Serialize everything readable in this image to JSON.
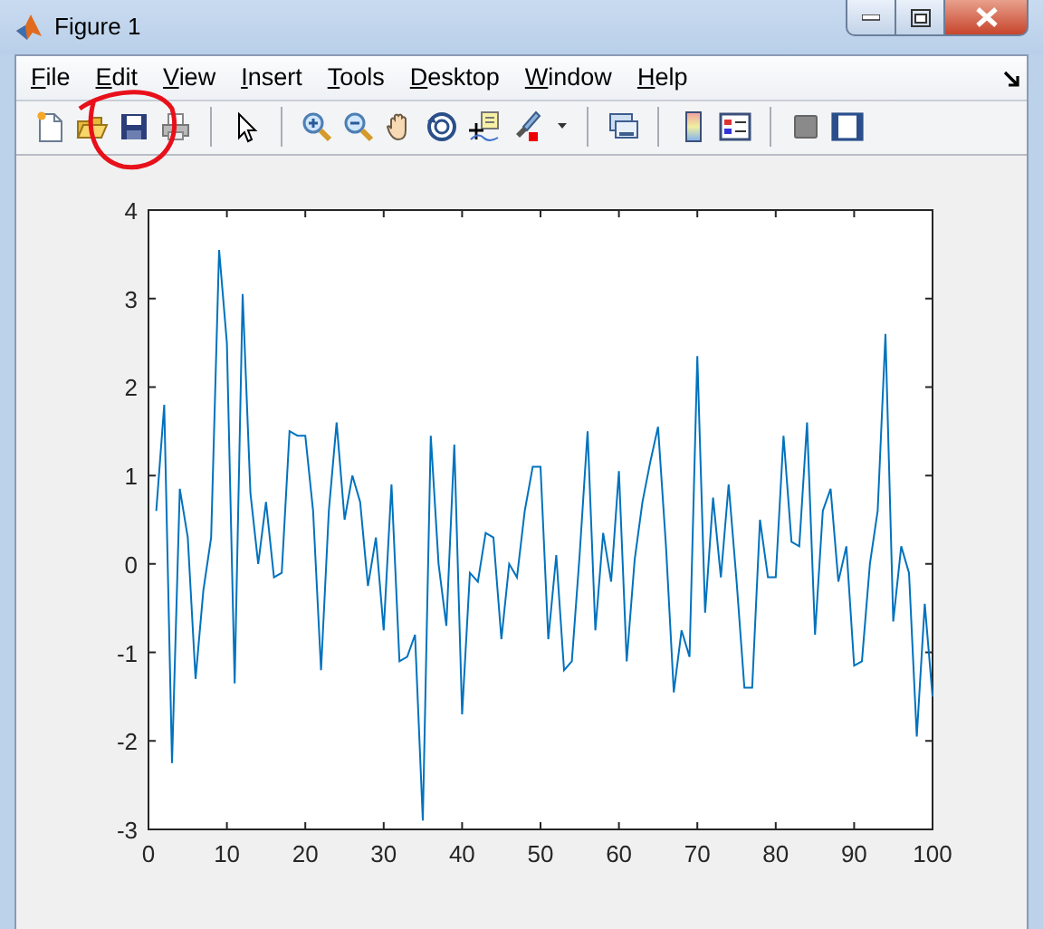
{
  "window": {
    "title": "Figure 1"
  },
  "menu_bar": {
    "items": [
      "File",
      "Edit",
      "View",
      "Insert",
      "Tools",
      "Desktop",
      "Window",
      "Help"
    ]
  },
  "figure": {
    "chart_data": {
      "type": "line",
      "x": [
        1,
        2,
        3,
        4,
        5,
        6,
        7,
        8,
        9,
        10,
        11,
        12,
        13,
        14,
        15,
        16,
        17,
        18,
        19,
        20,
        21,
        22,
        23,
        24,
        25,
        26,
        27,
        28,
        29,
        30,
        31,
        32,
        33,
        34,
        35,
        36,
        37,
        38,
        39,
        40,
        41,
        42,
        43,
        44,
        45,
        46,
        47,
        48,
        49,
        50,
        51,
        52,
        53,
        54,
        55,
        56,
        57,
        58,
        59,
        60,
        61,
        62,
        63,
        64,
        65,
        66,
        67,
        68,
        69,
        70,
        71,
        72,
        73,
        74,
        75,
        76,
        77,
        78,
        79,
        80,
        81,
        82,
        83,
        84,
        85,
        86,
        87,
        88,
        89,
        90,
        91,
        92,
        93,
        94,
        95,
        96,
        97,
        98,
        99,
        100
      ],
      "series": [
        {
          "color": "#0072bd",
          "values": [
            0.6,
            1.8,
            -2.25,
            0.85,
            0.3,
            -1.3,
            -0.3,
            0.3,
            3.55,
            2.5,
            -1.35,
            3.05,
            0.8,
            0.0,
            0.7,
            -0.15,
            -0.1,
            1.5,
            1.45,
            1.45,
            0.6,
            -1.2,
            0.6,
            1.6,
            0.5,
            1.0,
            0.7,
            -0.25,
            0.3,
            -0.75,
            0.9,
            -1.1,
            -1.05,
            -0.8,
            -2.9,
            1.45,
            0.0,
            -0.7,
            1.35,
            -1.7,
            -0.1,
            -0.2,
            0.35,
            0.3,
            -0.85,
            0.0,
            -0.15,
            0.6,
            1.1,
            1.1,
            -0.85,
            0.1,
            -1.2,
            -1.1,
            0.1,
            1.5,
            -0.75,
            0.35,
            -0.2,
            1.05,
            -1.1,
            0.05,
            0.7,
            1.15,
            1.55,
            0.2,
            -1.45,
            -0.75,
            -1.05,
            2.35,
            -0.55,
            0.75,
            -0.15,
            0.9,
            -0.2,
            -1.4,
            -1.4,
            0.5,
            -0.15,
            -0.15,
            1.45,
            0.25,
            0.2,
            1.6,
            -0.8,
            0.6,
            0.85,
            -0.2,
            0.2,
            -1.15,
            -1.1,
            0.0,
            0.6,
            2.6,
            -0.65,
            0.2,
            -0.1,
            -1.95,
            -0.45,
            -1.5
          ]
        }
      ],
      "xlim": [
        0,
        100
      ],
      "ylim": [
        -3,
        4
      ],
      "xticks": [
        0,
        10,
        20,
        30,
        40,
        50,
        60,
        70,
        80,
        90,
        100
      ],
      "yticks": [
        -3,
        -2,
        -1,
        0,
        1,
        2,
        3,
        4
      ]
    }
  }
}
